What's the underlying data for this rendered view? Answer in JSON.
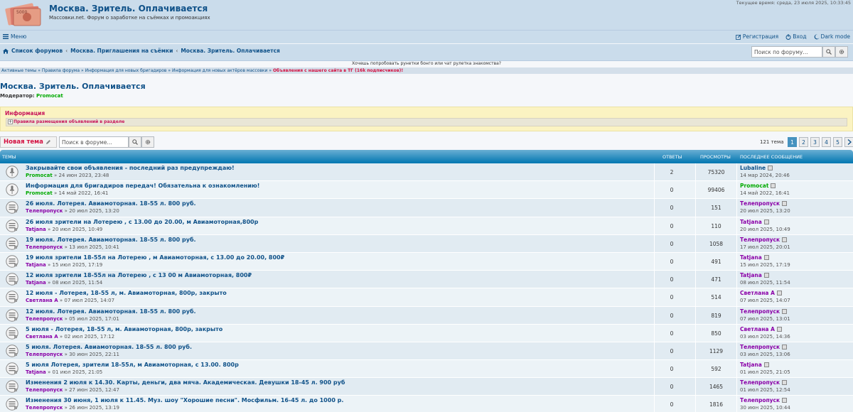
{
  "header": {
    "title": "Москва. Зритель. Оплачивается",
    "description": "Массовки.net. Форум о заработке на съёмках и промоакциях",
    "time": "Текущее время: среда, 23 июля 2025, 10:33:45"
  },
  "nav": {
    "menu": "Меню",
    "register": "Регистрация",
    "login": "Вход",
    "dark": "Dark mode"
  },
  "breadcrumbs": [
    "Список форумов",
    "Москва. Приглашения на съёмки",
    "Москва. Зритель. Оплачивается"
  ],
  "search": {
    "placeholder": "Поиск по форуму…"
  },
  "promo": "Хочешь попробовать рунетки бонго или чат рулетка знакомства?",
  "quicklinks": {
    "items": [
      "Активные темы",
      "Правила форума",
      "Информация для новых бригадиров",
      "Информация для новых актёров массовки"
    ],
    "highlight": "Объявления с нашего сайта в ТГ (16k подписчиков)!"
  },
  "forum": {
    "title": "Москва. Зритель. Оплачивается",
    "moderator_label": "Модератор:",
    "moderator": "Promocat"
  },
  "info": {
    "title": "Информация",
    "rule": "Правила размещения объявлений в разделе"
  },
  "toolbar": {
    "new_topic": "Новая тема",
    "search_placeholder": "Поиск в форуме…",
    "topic_count": "121 тема",
    "pages": [
      "1",
      "2",
      "3",
      "4",
      "5"
    ]
  },
  "table_headers": {
    "topics": "ТЕМЫ",
    "replies": "ОТВЕТЫ",
    "views": "ПРОСМОТРЫ",
    "last": "ПОСЛЕДНЕЕ СООБЩЕНИЕ"
  },
  "topics": [
    {
      "title": "Закрывайте свои объявления - последний раз предупреждаю!",
      "author": "Promocat",
      "authorColor": "green",
      "date": "24 июн 2023, 23:48",
      "replies": "2",
      "views": "75320",
      "lastAuthor": "Lubaline",
      "lastColor": "blue",
      "lastDate": "14 мар 2024, 20:46",
      "sticky": true
    },
    {
      "title": "Информация для бригадиров передач! Обязательна к ознакомлению!",
      "author": "Promocat",
      "authorColor": "green",
      "date": "14 май 2022, 16:41",
      "replies": "0",
      "views": "99406",
      "lastAuthor": "Promocat",
      "lastColor": "green",
      "lastDate": "14 май 2022, 16:41",
      "sticky": true
    },
    {
      "title": "26 июля. Лотерея. Авиамоторная. 18-55 л. 800 руб.",
      "author": "Телепропуск",
      "authorColor": "purple",
      "date": "20 июл 2025, 13:20",
      "replies": "0",
      "views": "151",
      "lastAuthor": "Телепропуск",
      "lastColor": "purple",
      "lastDate": "20 июл 2025, 13:20"
    },
    {
      "title": "26 июля зрители на Лотерею , с 13.00 до 20.00, м Авиамоторная,800р",
      "author": "Tatjana",
      "authorColor": "purple",
      "date": "20 июл 2025, 10:49",
      "replies": "0",
      "views": "110",
      "lastAuthor": "Tatjana",
      "lastColor": "purple",
      "lastDate": "20 июл 2025, 10:49"
    },
    {
      "title": "19 июля. Лотерея. Авиамоторная. 18-55 л. 800 руб.",
      "author": "Телепропуск",
      "authorColor": "purple",
      "date": "13 июл 2025, 10:41",
      "replies": "0",
      "views": "1058",
      "lastAuthor": "Телепропуск",
      "lastColor": "purple",
      "lastDate": "17 июл 2025, 20:01"
    },
    {
      "title": "19 июля зрители 18-55л на Лотерею , м Авиамоторная, с 13.00 до 20.00, 800₽",
      "author": "Tatjana",
      "authorColor": "purple",
      "date": "15 июл 2025, 17:19",
      "replies": "0",
      "views": "491",
      "lastAuthor": "Tatjana",
      "lastColor": "purple",
      "lastDate": "15 июл 2025, 17:19"
    },
    {
      "title": "12 июля зрители 18-55л на Лотерею , с 13 00 м Авиамоторная, 800₽",
      "author": "Tatjana",
      "authorColor": "purple",
      "date": "08 июл 2025, 11:54",
      "replies": "0",
      "views": "471",
      "lastAuthor": "Tatjana",
      "lastColor": "purple",
      "lastDate": "08 июл 2025, 11:54"
    },
    {
      "title": "12 июля - Лотерея, 18-55 л, м. Авиамоторная, 800р, закрыто",
      "author": "Светлана А",
      "authorColor": "purple",
      "date": "07 июл 2025, 14:07",
      "replies": "0",
      "views": "514",
      "lastAuthor": "Светлана А",
      "lastColor": "purple",
      "lastDate": "07 июл 2025, 14:07"
    },
    {
      "title": "12 июля. Лотерея. Авиамоторная. 18-55 л. 800 руб.",
      "author": "Телепропуск",
      "authorColor": "purple",
      "date": "05 июл 2025, 17:01",
      "replies": "0",
      "views": "819",
      "lastAuthor": "Телепропуск",
      "lastColor": "purple",
      "lastDate": "07 июл 2025, 13:01"
    },
    {
      "title": "5 июля - Лотерея, 18-55 л, м. Авиамоторная, 800р, закрыто",
      "author": "Светлана А",
      "authorColor": "purple",
      "date": "02 июл 2025, 17:12",
      "replies": "0",
      "views": "850",
      "lastAuthor": "Светлана А",
      "lastColor": "purple",
      "lastDate": "03 июл 2025, 14:36"
    },
    {
      "title": "5 июля. Лотерея. Авиамоторная. 18-55 л. 800 руб.",
      "author": "Телепропуск",
      "authorColor": "purple",
      "date": "30 июн 2025, 22:11",
      "replies": "0",
      "views": "1129",
      "lastAuthor": "Телепропуск",
      "lastColor": "purple",
      "lastDate": "03 июл 2025, 13:06"
    },
    {
      "title": "5 июля Лотерея, зрители 18-55л, м Авиамоторная, с 13.00. 800р",
      "author": "Tatjana",
      "authorColor": "purple",
      "date": "01 июл 2025, 21:05",
      "replies": "0",
      "views": "592",
      "lastAuthor": "Tatjana",
      "lastColor": "purple",
      "lastDate": "01 июл 2025, 21:05"
    },
    {
      "title": "Изменения 2 июля к 14.30. Карты, деньги, два мяча. Академическая. Девушки 18-45 л. 900 руб",
      "author": "Телепропуск",
      "authorColor": "purple",
      "date": "27 июн 2025, 12:47",
      "replies": "0",
      "views": "1465",
      "lastAuthor": "Телепропуск",
      "lastColor": "purple",
      "lastDate": "01 июл 2025, 12:54"
    },
    {
      "title": "Изменения 30 июня, 1 июля к 11.45. Муз. шоу \"Хорошие песни\". Мосфильм. 16-45 л. до 1000 р.",
      "author": "Телепропуск",
      "authorColor": "purple",
      "date": "26 июн 2025, 13:19",
      "replies": "0",
      "views": "1816",
      "lastAuthor": "Телепропуск",
      "lastColor": "purple",
      "lastDate": "30 июн 2025, 10:44"
    }
  ]
}
